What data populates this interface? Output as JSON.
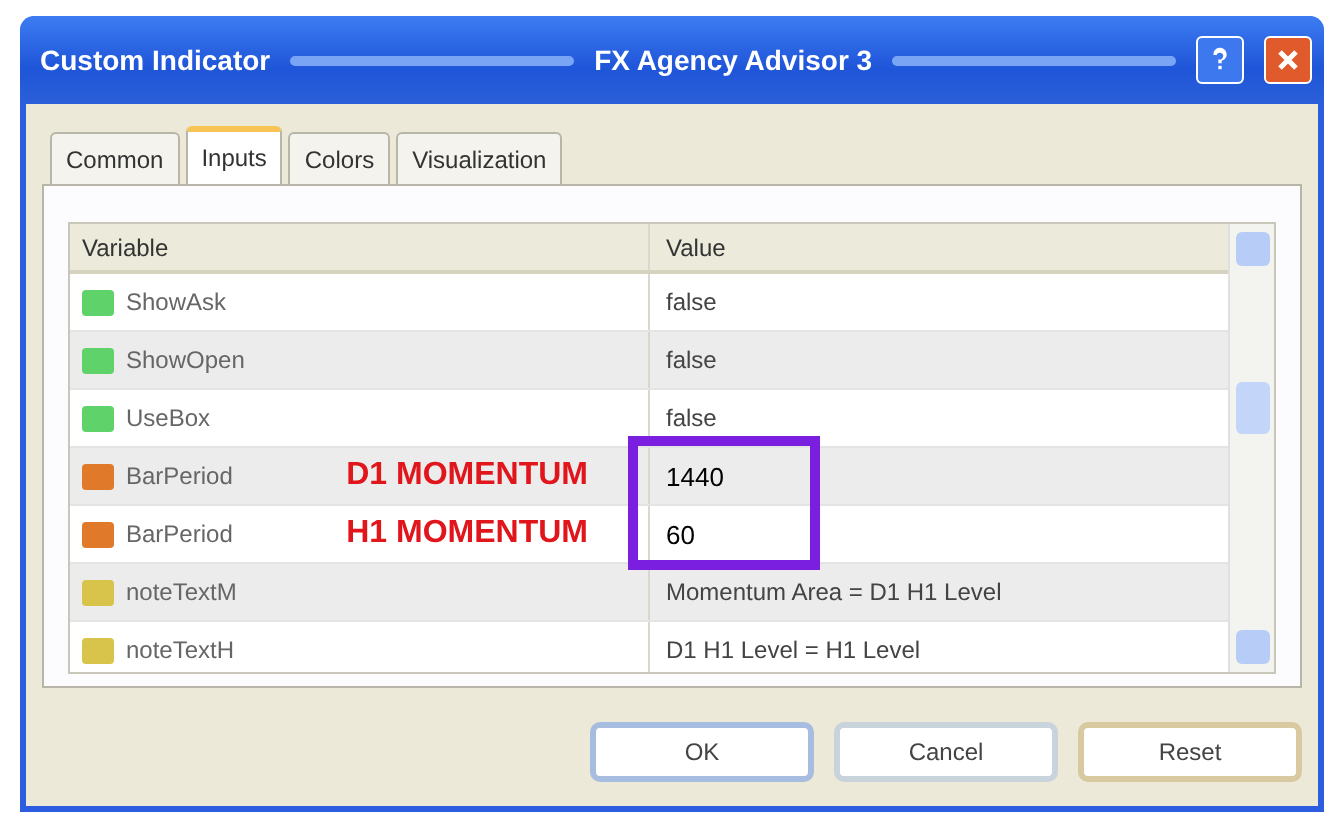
{
  "window": {
    "title_left": "Custom Indicator",
    "title_right": "FX Agency Advisor 3"
  },
  "tabs": [
    {
      "label": "Common",
      "selected": false
    },
    {
      "label": "Inputs",
      "selected": true
    },
    {
      "label": "Colors",
      "selected": false
    },
    {
      "label": "Visualization",
      "selected": false
    }
  ],
  "table": {
    "columns": [
      "Variable",
      "Value"
    ],
    "rows": [
      {
        "kind": "bool",
        "name": "ShowAsk",
        "value": "false"
      },
      {
        "kind": "bool",
        "name": "ShowOpen",
        "value": "false"
      },
      {
        "kind": "bool",
        "name": "UseBox",
        "value": "false"
      },
      {
        "kind": "int",
        "name": "BarPeriod",
        "annotation": "D1 MOMENTUM",
        "value": "1440"
      },
      {
        "kind": "int",
        "name": "BarPeriod",
        "annotation": "H1 MOMENTUM",
        "value": "60"
      },
      {
        "kind": "string",
        "name": "noteTextM",
        "value": "Momentum Area = D1 H1 Level"
      },
      {
        "kind": "string",
        "name": "noteTextH",
        "value": "D1 H1 Level = H1 Level"
      }
    ]
  },
  "buttons": [
    "OK",
    "Cancel",
    "Reset"
  ]
}
